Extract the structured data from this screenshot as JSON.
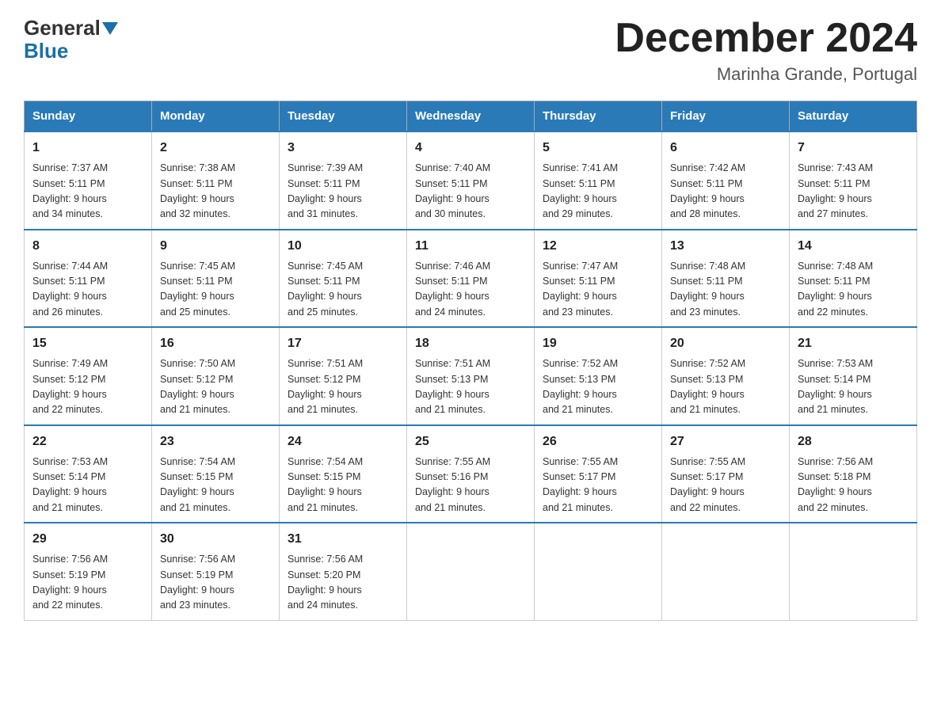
{
  "header": {
    "logo_general": "General",
    "logo_blue": "Blue",
    "main_title": "December 2024",
    "subtitle": "Marinha Grande, Portugal"
  },
  "days_of_week": [
    "Sunday",
    "Monday",
    "Tuesday",
    "Wednesday",
    "Thursday",
    "Friday",
    "Saturday"
  ],
  "weeks": [
    [
      {
        "day": "1",
        "sunrise": "7:37 AM",
        "sunset": "5:11 PM",
        "daylight": "9 hours and 34 minutes."
      },
      {
        "day": "2",
        "sunrise": "7:38 AM",
        "sunset": "5:11 PM",
        "daylight": "9 hours and 32 minutes."
      },
      {
        "day": "3",
        "sunrise": "7:39 AM",
        "sunset": "5:11 PM",
        "daylight": "9 hours and 31 minutes."
      },
      {
        "day": "4",
        "sunrise": "7:40 AM",
        "sunset": "5:11 PM",
        "daylight": "9 hours and 30 minutes."
      },
      {
        "day": "5",
        "sunrise": "7:41 AM",
        "sunset": "5:11 PM",
        "daylight": "9 hours and 29 minutes."
      },
      {
        "day": "6",
        "sunrise": "7:42 AM",
        "sunset": "5:11 PM",
        "daylight": "9 hours and 28 minutes."
      },
      {
        "day": "7",
        "sunrise": "7:43 AM",
        "sunset": "5:11 PM",
        "daylight": "9 hours and 27 minutes."
      }
    ],
    [
      {
        "day": "8",
        "sunrise": "7:44 AM",
        "sunset": "5:11 PM",
        "daylight": "9 hours and 26 minutes."
      },
      {
        "day": "9",
        "sunrise": "7:45 AM",
        "sunset": "5:11 PM",
        "daylight": "9 hours and 25 minutes."
      },
      {
        "day": "10",
        "sunrise": "7:45 AM",
        "sunset": "5:11 PM",
        "daylight": "9 hours and 25 minutes."
      },
      {
        "day": "11",
        "sunrise": "7:46 AM",
        "sunset": "5:11 PM",
        "daylight": "9 hours and 24 minutes."
      },
      {
        "day": "12",
        "sunrise": "7:47 AM",
        "sunset": "5:11 PM",
        "daylight": "9 hours and 23 minutes."
      },
      {
        "day": "13",
        "sunrise": "7:48 AM",
        "sunset": "5:11 PM",
        "daylight": "9 hours and 23 minutes."
      },
      {
        "day": "14",
        "sunrise": "7:48 AM",
        "sunset": "5:11 PM",
        "daylight": "9 hours and 22 minutes."
      }
    ],
    [
      {
        "day": "15",
        "sunrise": "7:49 AM",
        "sunset": "5:12 PM",
        "daylight": "9 hours and 22 minutes."
      },
      {
        "day": "16",
        "sunrise": "7:50 AM",
        "sunset": "5:12 PM",
        "daylight": "9 hours and 21 minutes."
      },
      {
        "day": "17",
        "sunrise": "7:51 AM",
        "sunset": "5:12 PM",
        "daylight": "9 hours and 21 minutes."
      },
      {
        "day": "18",
        "sunrise": "7:51 AM",
        "sunset": "5:13 PM",
        "daylight": "9 hours and 21 minutes."
      },
      {
        "day": "19",
        "sunrise": "7:52 AM",
        "sunset": "5:13 PM",
        "daylight": "9 hours and 21 minutes."
      },
      {
        "day": "20",
        "sunrise": "7:52 AM",
        "sunset": "5:13 PM",
        "daylight": "9 hours and 21 minutes."
      },
      {
        "day": "21",
        "sunrise": "7:53 AM",
        "sunset": "5:14 PM",
        "daylight": "9 hours and 21 minutes."
      }
    ],
    [
      {
        "day": "22",
        "sunrise": "7:53 AM",
        "sunset": "5:14 PM",
        "daylight": "9 hours and 21 minutes."
      },
      {
        "day": "23",
        "sunrise": "7:54 AM",
        "sunset": "5:15 PM",
        "daylight": "9 hours and 21 minutes."
      },
      {
        "day": "24",
        "sunrise": "7:54 AM",
        "sunset": "5:15 PM",
        "daylight": "9 hours and 21 minutes."
      },
      {
        "day": "25",
        "sunrise": "7:55 AM",
        "sunset": "5:16 PM",
        "daylight": "9 hours and 21 minutes."
      },
      {
        "day": "26",
        "sunrise": "7:55 AM",
        "sunset": "5:17 PM",
        "daylight": "9 hours and 21 minutes."
      },
      {
        "day": "27",
        "sunrise": "7:55 AM",
        "sunset": "5:17 PM",
        "daylight": "9 hours and 22 minutes."
      },
      {
        "day": "28",
        "sunrise": "7:56 AM",
        "sunset": "5:18 PM",
        "daylight": "9 hours and 22 minutes."
      }
    ],
    [
      {
        "day": "29",
        "sunrise": "7:56 AM",
        "sunset": "5:19 PM",
        "daylight": "9 hours and 22 minutes."
      },
      {
        "day": "30",
        "sunrise": "7:56 AM",
        "sunset": "5:19 PM",
        "daylight": "9 hours and 23 minutes."
      },
      {
        "day": "31",
        "sunrise": "7:56 AM",
        "sunset": "5:20 PM",
        "daylight": "9 hours and 24 minutes."
      },
      null,
      null,
      null,
      null
    ]
  ],
  "labels": {
    "sunrise": "Sunrise:",
    "sunset": "Sunset:",
    "daylight": "Daylight:"
  }
}
